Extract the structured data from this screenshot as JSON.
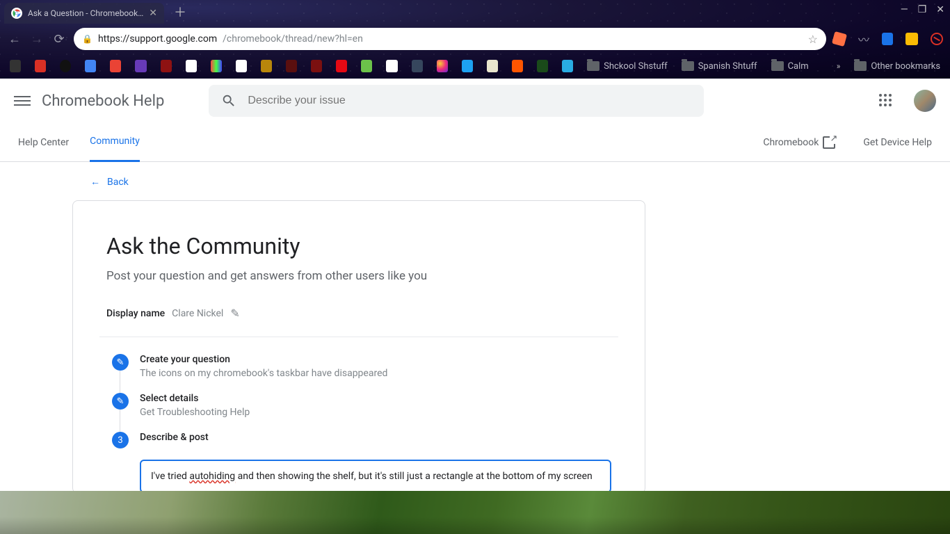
{
  "browser": {
    "tab_title": "Ask a Question - Chromebook H…",
    "url_host": "https://support.google.com",
    "url_path": "/chromebook/thread/new?hl=en",
    "bookmark_folders": [
      "Shckool Shstuff",
      "Spanish Shtuff",
      "Calm"
    ],
    "other_bookmarks": "Other bookmarks"
  },
  "header": {
    "brand": "Chromebook Help",
    "search_placeholder": "Describe your issue"
  },
  "subnav": {
    "help_center": "Help Center",
    "community": "Community",
    "product": "Chromebook",
    "device_help": "Get Device Help"
  },
  "page": {
    "back": "Back",
    "h1": "Ask the Community",
    "subtitle": "Post your question and get answers from other users like you",
    "display_name_label": "Display name",
    "display_name_value": "Clare Nickel",
    "steps": {
      "s1_title": "Create your question",
      "s1_desc": "The icons on my chromebook's taskbar have disappeared",
      "s2_title": "Select details",
      "s2_desc": "Get Troubleshooting Help",
      "s3_title": "Describe & post",
      "s3_num": "3"
    },
    "describe_pre": "I've tried ",
    "describe_err": "autohiding",
    "describe_post": " and then showing the shelf, but it's still just a rectangle at the bottom of my screen"
  }
}
